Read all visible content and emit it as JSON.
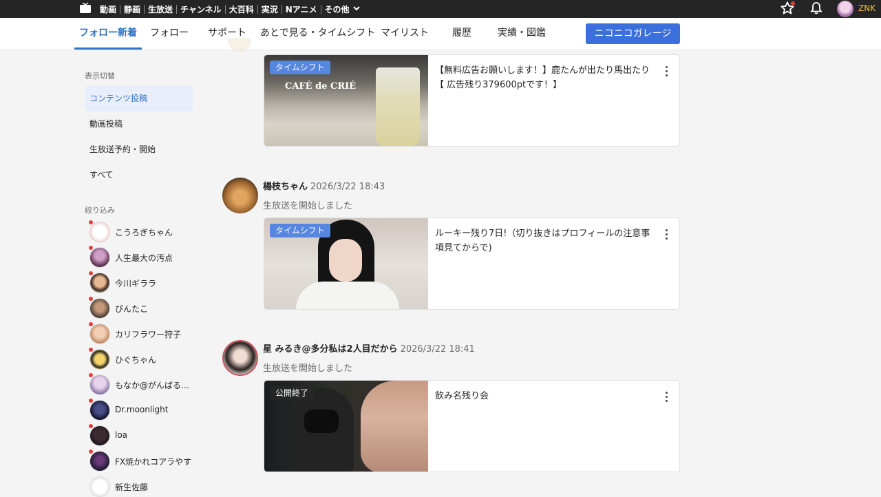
{
  "topbar": {
    "links": [
      "動画",
      "静画",
      "生放送",
      "チャンネル",
      "大百科",
      "実況",
      "Nアニメ"
    ],
    "more_label": "その他",
    "username": "ZNK",
    "icons": [
      "niconico-tv-icon",
      "star-icon",
      "bell-icon",
      "chevron-down-icon"
    ]
  },
  "nav": {
    "tabs": [
      "フォロー新着",
      "フォロー",
      "サポート",
      "あとで見る・タイムシフト",
      "マイリスト",
      "履歴",
      "実績・図鑑"
    ],
    "active_tab": "フォロー新着",
    "garage_button": "ニコニコガレージ"
  },
  "sidebar": {
    "display_heading": "表示切替",
    "display_items": [
      "コンテンツ投稿",
      "動画投稿",
      "生放送予約・開始",
      "すべて"
    ],
    "active_item": "コンテンツ投稿",
    "filter_heading": "絞り込み",
    "filter_users": [
      "こうろぎちゃん",
      "人生最大の汚点",
      "今川ギララ",
      "ぴんたこ",
      "カリフラワー狩子",
      "ひぐちゃん",
      "もなか@がんばる…",
      "Dr.moonlight",
      "loa",
      "FX焼かれコアラやす",
      "新生佐藤"
    ]
  },
  "feed": {
    "posts": [
      {
        "card": {
          "badge": "タイムシフト",
          "title": "【無料広告お願いします！】鹿たんが出たり馬出たり【 広告残り379600ptです！】",
          "thumb_text": "CAFÉ de CRIÉ"
        }
      },
      {
        "author": "楊枝ちゃん",
        "date": "2026/3/22 18:43",
        "action": "生放送を開始しました",
        "card": {
          "badge": "タイムシフト",
          "title": "ルーキー残り7日!（切り抜きはプロフィールの注意事項見てからで)"
        }
      },
      {
        "author": "星 みるき@多分私は2人目だから",
        "date": "2026/3/22 18:41",
        "action": "生放送を開始しました",
        "card": {
          "badge": "公開終了",
          "title": "飲み名残り会"
        }
      }
    ]
  },
  "colors": {
    "accent": "#2f72c7",
    "garage_button": "#3a6fdc",
    "badge_timeshift": "#5686e0",
    "notification_dot": "#e93c3c",
    "topbar_bg": "#252525"
  }
}
